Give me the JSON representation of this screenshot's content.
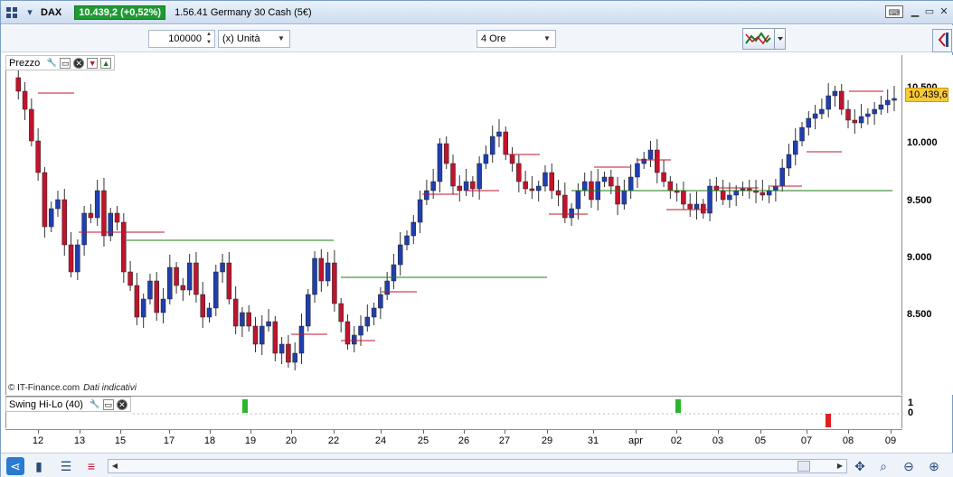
{
  "titlebar": {
    "instrument": "DAX",
    "price_change": "10.439,2 (+0,52%)",
    "description": "1.56.41 Germany 30 Cash (5€)"
  },
  "toolbar": {
    "quantity": "100000",
    "unit": "(x) Unità",
    "timeframe": "4 Ore"
  },
  "price_panel": {
    "label": "Prezzo",
    "copyright": "© IT-Finance.com",
    "disclaimer": "Dati indicativi",
    "last_price": "10.439,6",
    "y_ticks": [
      "10.500",
      "10.000",
      "9.500",
      "9.000",
      "8.500"
    ]
  },
  "indicator_panel": {
    "label": "Swing Hi-Lo (40)",
    "y_ticks": [
      "1",
      "0"
    ]
  },
  "x_ticks": [
    "12",
    "13",
    "15",
    "17",
    "18",
    "19",
    "20",
    "22",
    "24",
    "25",
    "26",
    "27",
    "29",
    "31",
    "apr",
    "02",
    "03",
    "05",
    "07",
    "08",
    "09"
  ],
  "colors": {
    "bull_candle": "#1f3fb0",
    "bear_candle": "#c0142d",
    "resistance_line": "#c0142d",
    "support_line": "#1a7a1a",
    "signal_up": "#2bb52b",
    "signal_down": "#e02020",
    "price_badge": "#1e9a33",
    "last_price_badge": "#f7c93a"
  },
  "icons": {
    "menu": "layout-grid-icon",
    "keyboard": "keyboard-icon",
    "share": "share-icon",
    "zoom_in": "zoom-in-icon",
    "zoom_out": "zoom-out-icon"
  }
}
